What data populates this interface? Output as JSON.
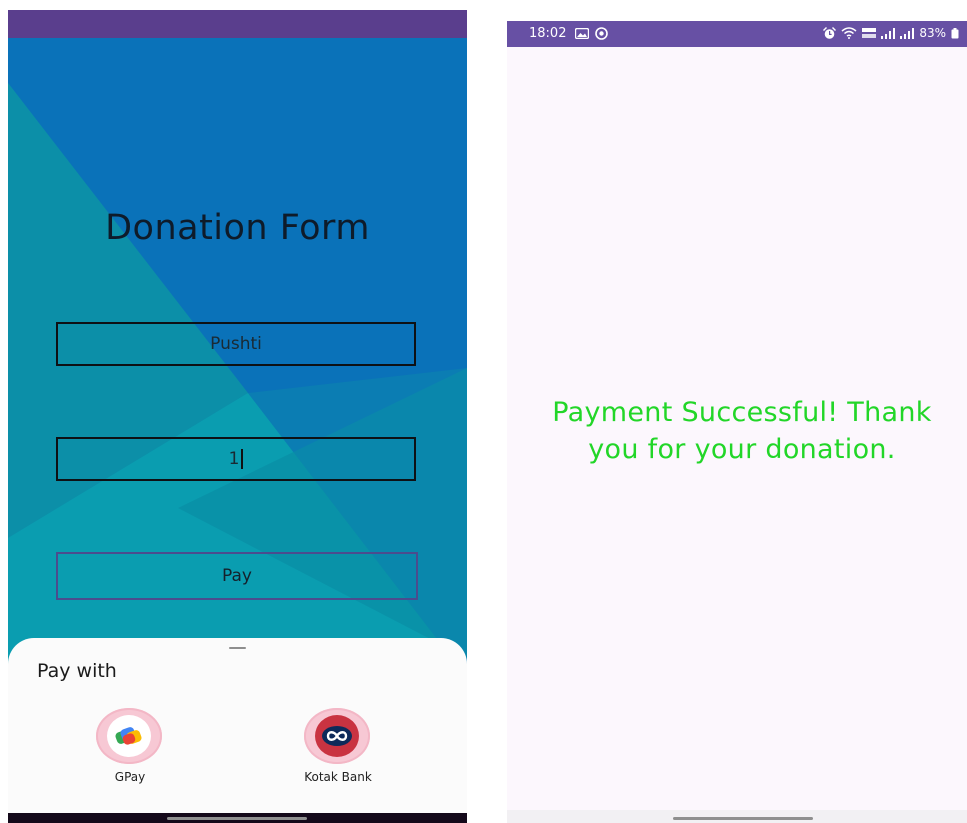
{
  "left_screen": {
    "title": "Donation Form",
    "name_field": {
      "value": "Pushti"
    },
    "amount_field": {
      "value": "1"
    },
    "pay_button": {
      "label": "Pay"
    },
    "payment_sheet": {
      "title": "Pay with",
      "options": [
        {
          "label": "GPay",
          "icon": "gpay-icon"
        },
        {
          "label": "Kotak Bank",
          "icon": "kotak-icon"
        }
      ]
    }
  },
  "right_screen": {
    "status_bar": {
      "time": "18:02",
      "battery": "83%"
    },
    "message": "Payment Successful! Thank you for your donation."
  },
  "colors": {
    "status_bar_left": "#5a3e8d",
    "status_bar_right": "#6750a4",
    "success_text": "#22d628",
    "background_blue": "#0a7ab8",
    "background_teal": "#0a9aa8"
  }
}
